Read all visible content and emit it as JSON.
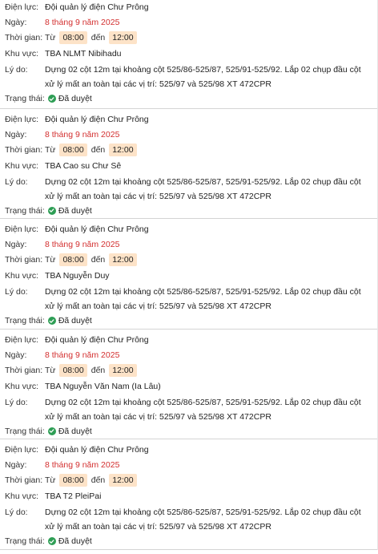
{
  "labels": {
    "unit": "Điện lực:",
    "date": "Ngày:",
    "time": "Thời gian:",
    "area": "Khu vực:",
    "reason": "Lý do:",
    "status": "Trạng thái:",
    "from": "Từ",
    "to": "đến"
  },
  "items": [
    {
      "unit": "Đội quản lý điện Chư Prông",
      "date": "8 tháng 9 năm 2025",
      "time_from": "08:00",
      "time_to": "12:00",
      "area": "TBA NLMT Nibihadu",
      "reason": "Dựng 02 cột 12m tại khoảng cột 525/86-525/87, 525/91-525/92. Lắp 02 chụp đầu cột xử lý mất an toàn tại các vị trí: 525/97 và 525/98 XT 472CPR",
      "status": "Đã duyệt"
    },
    {
      "unit": "Đội quản lý điện Chư Prông",
      "date": "8 tháng 9 năm 2025",
      "time_from": "08:00",
      "time_to": "12:00",
      "area": "TBA Cao su Chư Sê",
      "reason": "Dựng 02 cột 12m tại khoảng cột 525/86-525/87, 525/91-525/92. Lắp 02 chụp đầu cột xử lý mất an toàn tại các vị trí: 525/97 và 525/98 XT 472CPR",
      "status": "Đã duyệt"
    },
    {
      "unit": "Đội quản lý điện Chư Prông",
      "date": "8 tháng 9 năm 2025",
      "time_from": "08:00",
      "time_to": "12:00",
      "area": "TBA Nguyễn Duy",
      "reason": "Dựng 02 cột 12m tại khoảng cột 525/86-525/87, 525/91-525/92. Lắp 02 chụp đầu cột xử lý mất an toàn tại các vị trí: 525/97 và 525/98 XT 472CPR",
      "status": "Đã duyệt"
    },
    {
      "unit": "Đội quản lý điện Chư Prông",
      "date": "8 tháng 9 năm 2025",
      "time_from": "08:00",
      "time_to": "12:00",
      "area": "TBA Nguyễn Văn Nam (Ia Lâu)",
      "reason": "Dựng 02 cột 12m tại khoảng cột 525/86-525/87, 525/91-525/92. Lắp 02 chụp đầu cột xử lý mất an toàn tại các vị trí: 525/97 và 525/98 XT 472CPR",
      "status": "Đã duyệt"
    },
    {
      "unit": "Đội quản lý điện Chư Prông",
      "date": "8 tháng 9 năm 2025",
      "time_from": "08:00",
      "time_to": "12:00",
      "area": "TBA T2 PleiPai",
      "reason": "Dựng 02 cột 12m tại khoảng cột 525/86-525/87, 525/91-525/92. Lắp 02 chụp đầu cột xử lý mất an toàn tại các vị trí: 525/97 và 525/98 XT 472CPR",
      "status": "Đã duyệt"
    }
  ],
  "icons": {
    "status": "check-circle-icon"
  },
  "colors": {
    "date": "#d32f2f",
    "time_chip": "#fde3c8",
    "status_icon": "#2e9e55"
  }
}
